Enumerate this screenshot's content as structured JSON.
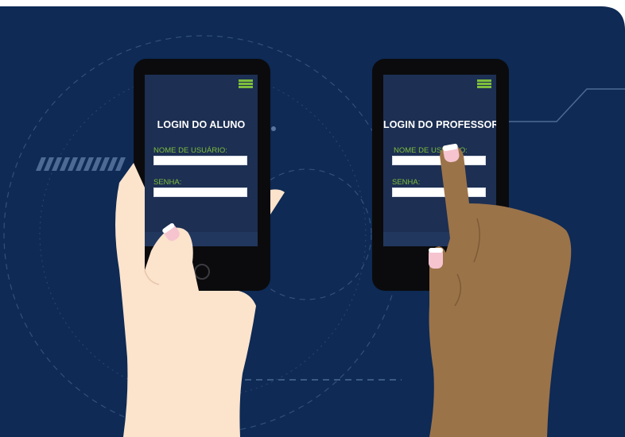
{
  "scene": {
    "background_color": "#0e2a55",
    "accent_color": "#7dbf3c",
    "screen_color": "#1d2f52"
  },
  "student_phone": {
    "menu_icon": "hamburger-menu-icon",
    "title": "LOGIN DO ALUNO",
    "username_label": "NOME DE USUÁRIO:",
    "password_label": "SENHA:"
  },
  "teacher_phone": {
    "menu_icon": "hamburger-menu-icon",
    "title": "LOGIN DO PROFESSOR",
    "username_label": "NOME DE USUÁRIO:",
    "password_label": "SENHA:"
  }
}
